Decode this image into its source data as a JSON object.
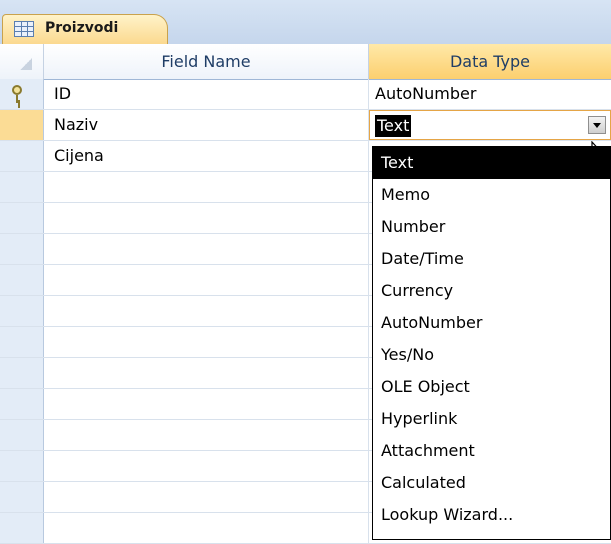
{
  "tab": {
    "label": "Proizvodi",
    "icon": "table-icon"
  },
  "columns": {
    "field_name": "Field Name",
    "data_type": "Data Type"
  },
  "rows": [
    {
      "field": "ID",
      "type": "AutoNumber",
      "primary_key": true
    },
    {
      "field": "Naziv",
      "type": "Text",
      "current": true
    },
    {
      "field": "Cijena",
      "type": ""
    },
    {
      "field": "",
      "type": ""
    },
    {
      "field": "",
      "type": ""
    },
    {
      "field": "",
      "type": ""
    },
    {
      "field": "",
      "type": ""
    },
    {
      "field": "",
      "type": ""
    },
    {
      "field": "",
      "type": ""
    },
    {
      "field": "",
      "type": ""
    },
    {
      "field": "",
      "type": ""
    },
    {
      "field": "",
      "type": ""
    },
    {
      "field": "",
      "type": ""
    },
    {
      "field": "",
      "type": ""
    },
    {
      "field": "",
      "type": ""
    }
  ],
  "combo": {
    "value": "Text"
  },
  "dropdown": {
    "selected": "Text",
    "options": [
      "Text",
      "Memo",
      "Number",
      "Date/Time",
      "Currency",
      "AutoNumber",
      "Yes/No",
      "OLE Object",
      "Hyperlink",
      "Attachment",
      "Calculated",
      "Lookup Wizard..."
    ]
  },
  "colors": {
    "header_accent": "#fccf6f",
    "selector": "#e3ecf7",
    "current_row": "#fbdc95",
    "combo_border": "#e5a546"
  }
}
